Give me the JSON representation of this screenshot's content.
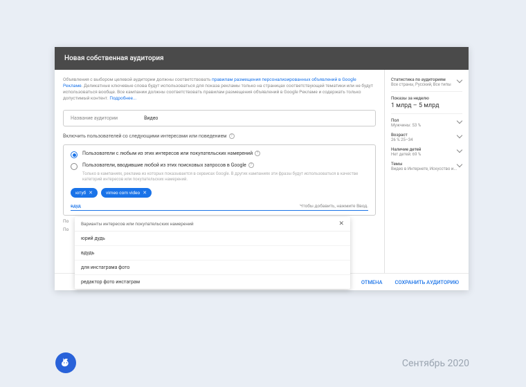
{
  "dialog": {
    "title": "Новая собственная аудитория",
    "notice_prefix": "Объявления с выбором целевой аудитории должны соответствовать ",
    "notice_link": "правилам размещения персонализированных объявлений в Google Рекламе",
    "notice_suffix": ". Деликатные ключевые слова будут использоваться для показа рекламы только на страницах соответствующей тематики или не будут использоваться вообще. Все кампании должны соответствовать правилам размещения объявлений в Google Рекламе и содержать только допустимый контент. ",
    "notice_more": "Подробнее...",
    "name_label": "Название аудитории",
    "name_value": "Видео",
    "include_title": "Включить пользователей со следующими интересами или поведением",
    "radio1": "Пользователи с любым из этих интересов или покупательских намерений",
    "radio2": "Пользователи, вводившие любой из этих поисковых запросов в Google",
    "radio2_sub": "Только в кампаниях, реклама из которых показывается в сервисах Google. В других кампаниях эти фразы будут использоваться в качестве категорий интересов или покупательских намерений.",
    "chips": [
      "ютуб",
      "vimeo com video"
    ],
    "input_prefix": "вдуд",
    "input_hint": "Чтобы добавить, нажмите Ввод.",
    "truncated_left": [
      "По",
      "По"
    ],
    "suggestions": {
      "header": "Варианты интересов или покупательских намерений",
      "items": [
        "юрий дудь",
        "вдудь",
        "для инстаграма фото",
        "редактор фото инстаграм"
      ]
    }
  },
  "sidebar": {
    "stats_title": "Статистика по аудиториям",
    "stats_sub": "Все страны, Русский, Все типы",
    "impressions_label": "Показы за неделю",
    "impressions_value": "1 млрд – 5 млрд",
    "gender_label": "Пол",
    "gender_value": "Мужчины: 53 %",
    "age_label": "Возраст",
    "age_value": "26 % 25–34",
    "parental_label": "Наличие детей",
    "parental_value": "Нет детей: 69 %",
    "topics_label": "Темы",
    "topics_value": "Видео в Интернете, Искусство и..."
  },
  "actions": {
    "cancel": "ОТМЕНА",
    "save": "СОХРАНИТЬ АУДИТОРИЮ"
  },
  "caption": "Сентябрь 2020"
}
